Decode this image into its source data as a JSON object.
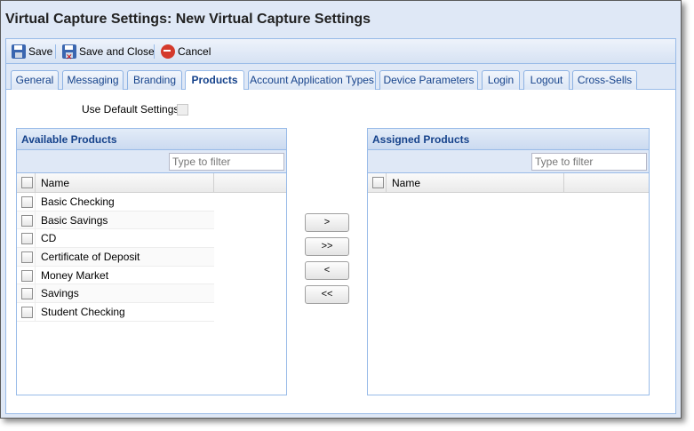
{
  "window": {
    "title": "Virtual Capture Settings: New Virtual Capture Settings"
  },
  "toolbar": {
    "save_label": "Save",
    "save_close_label": "Save and Close",
    "cancel_label": "Cancel"
  },
  "tabs": [
    {
      "label": "General"
    },
    {
      "label": "Messaging"
    },
    {
      "label": "Branding"
    },
    {
      "label": "Products",
      "active": true
    },
    {
      "label": "Account Application Types"
    },
    {
      "label": "Device Parameters"
    },
    {
      "label": "Login"
    },
    {
      "label": "Logout"
    },
    {
      "label": "Cross-Sells"
    }
  ],
  "default_settings": {
    "label": "Use Default Settings:"
  },
  "available": {
    "title": "Available Products",
    "filter_placeholder": "Type to filter",
    "column_name": "Name",
    "items": [
      {
        "name": "Basic Checking"
      },
      {
        "name": "Basic Savings"
      },
      {
        "name": "CD"
      },
      {
        "name": "Certificate of Deposit"
      },
      {
        "name": "Money Market"
      },
      {
        "name": "Savings"
      },
      {
        "name": "Student Checking"
      }
    ]
  },
  "assigned": {
    "title": "Assigned Products",
    "filter_placeholder": "Type to filter",
    "column_name": "Name",
    "items": []
  },
  "move_buttons": {
    "add": ">",
    "add_all": ">>",
    "remove": "<",
    "remove_all": "<<"
  }
}
